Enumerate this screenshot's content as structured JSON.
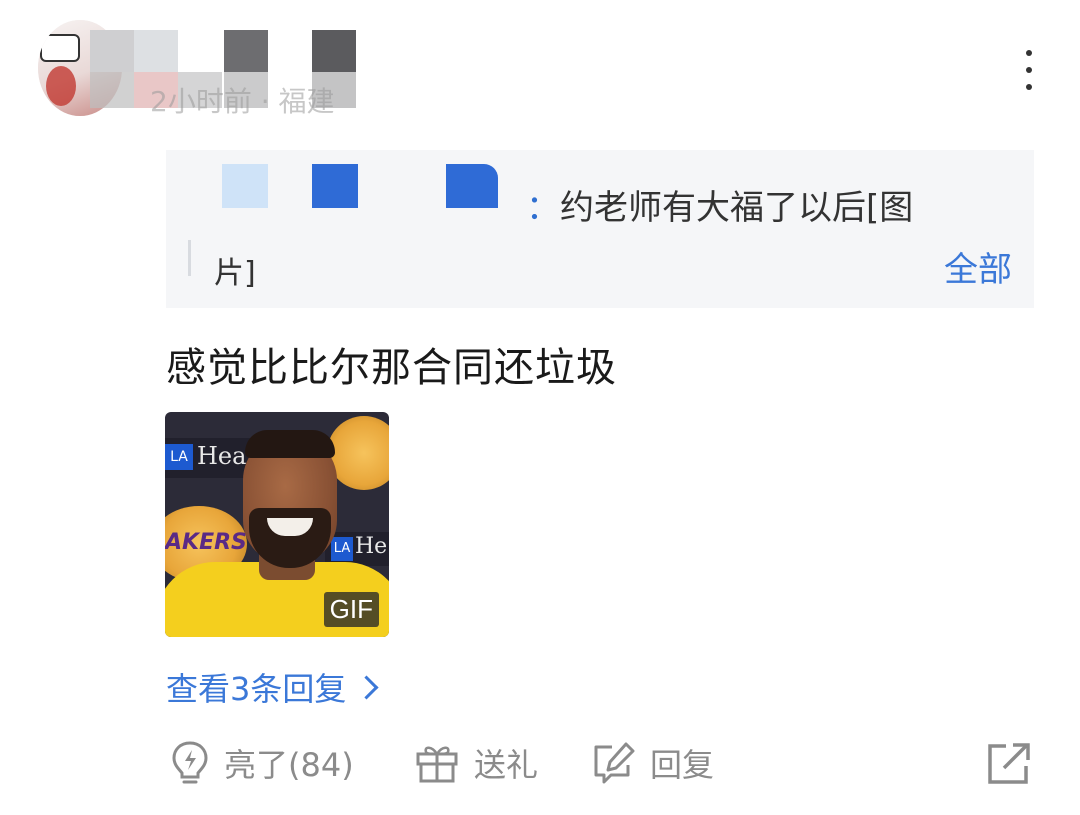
{
  "header": {
    "meta_text": "2小时前 · 福建"
  },
  "quote": {
    "text_line1": "约老师有大福了以后[图",
    "text_line2": "片]",
    "colon": "：",
    "expand_label": "全部"
  },
  "comment": {
    "text": "感觉比比尔那合同还垃圾",
    "image_badge": "GIF",
    "gif_banner_text_1": "Healt",
    "gif_banner_text_2": "He",
    "gif_logo_text": "AKERS"
  },
  "replies": {
    "view_label": "查看3条回复"
  },
  "actions": {
    "like_label": "亮了(84)",
    "gift_label": "送礼",
    "reply_label": "回复"
  },
  "colors": {
    "link": "#3b78d8",
    "muted": "#8b8b8b",
    "quote_bg": "#f5f6f8"
  }
}
